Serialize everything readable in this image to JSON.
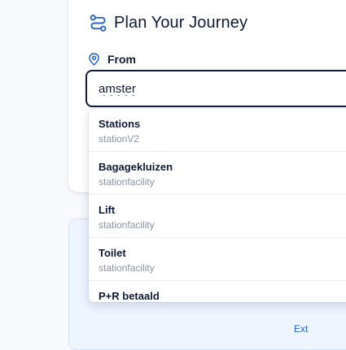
{
  "planner": {
    "title": "Plan Your Journey",
    "from_label": "From",
    "from_value": "amster"
  },
  "suggestions": [
    {
      "name": "Stations",
      "type": "stationV2"
    },
    {
      "name": "Bagagekluizen",
      "type": "stationfacility"
    },
    {
      "name": "Lift",
      "type": "stationfacility"
    },
    {
      "name": "Toilet",
      "type": "stationfacility"
    },
    {
      "name": "P+R betaald",
      "type": ""
    }
  ],
  "secondary_card": {
    "link_text": "Ext"
  },
  "icons": {
    "title": "route-icon",
    "from": "map-pin-icon"
  },
  "colors": {
    "text_primary": "#0f1b35",
    "accent_blue": "#2d64c8",
    "muted_text": "#8a93a3",
    "card2_bg": "#eff5fe"
  }
}
